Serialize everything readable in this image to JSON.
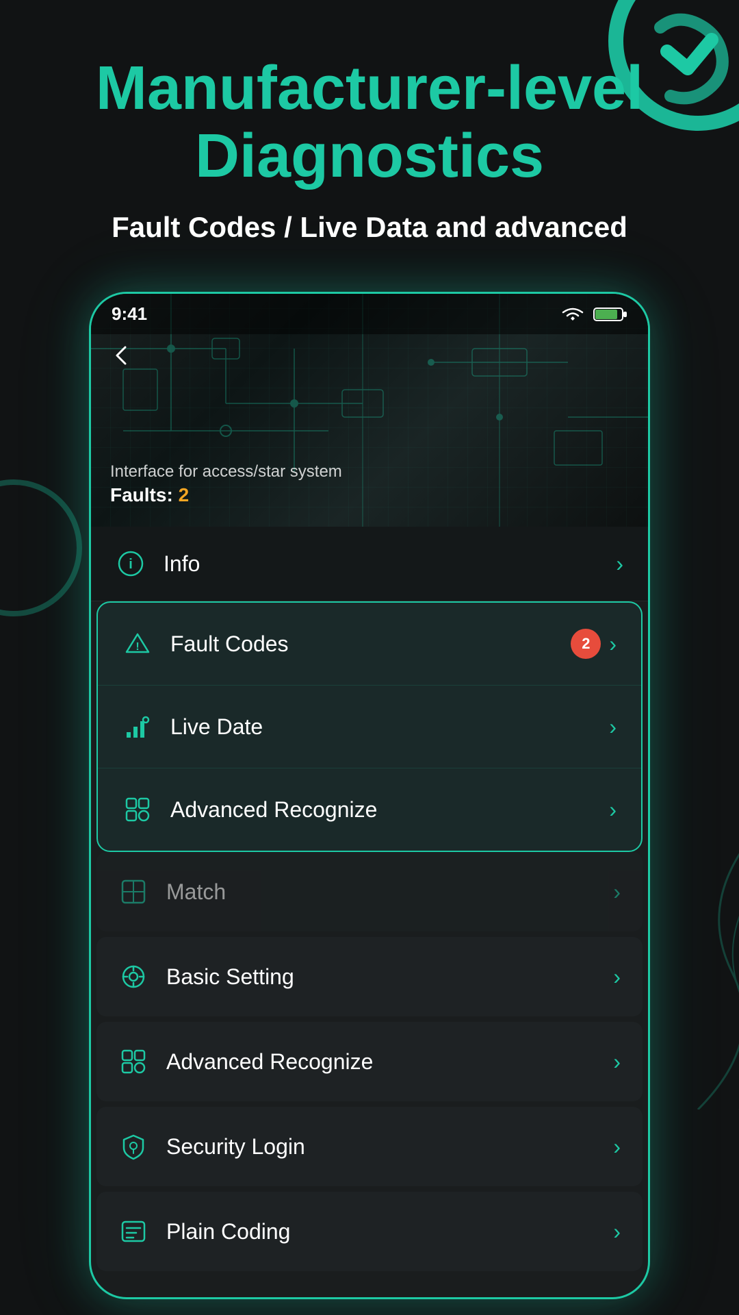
{
  "header": {
    "title_line1": "Manufacturer-level",
    "title_line2": "Diagnostics",
    "subtitle": "Fault Codes / Live Data and advanced"
  },
  "phone": {
    "status_bar": {
      "time": "9:41"
    },
    "hero": {
      "back_label": "‹",
      "interface_label": "Interface for access/star system",
      "faults_label": "Faults:",
      "faults_count": "2"
    },
    "info_item": {
      "label": "Info",
      "icon": "ℹ"
    },
    "highlighted_items": [
      {
        "label": "Fault Codes",
        "icon": "warning",
        "badge": "2",
        "has_badge": true
      },
      {
        "label": "Live Date",
        "icon": "chart",
        "has_badge": false
      },
      {
        "label": "Advanced Recognize",
        "icon": "scan",
        "has_badge": false
      }
    ],
    "match_item": {
      "label": "Match",
      "icon": "match"
    },
    "lower_items": [
      {
        "label": "Basic Setting",
        "icon": "gear"
      },
      {
        "label": "Advanced Recognize",
        "icon": "scan"
      },
      {
        "label": "Security Login",
        "icon": "shield"
      },
      {
        "label": "Plain Coding",
        "icon": "code"
      }
    ]
  },
  "colors": {
    "accent": "#1dc9a4",
    "bg_dark": "#111314",
    "bg_card": "#1e2224",
    "text_primary": "#ffffff",
    "text_muted": "rgba(255,255,255,0.7)",
    "badge_red": "#e74c3c",
    "faults_orange": "#f5a623"
  }
}
